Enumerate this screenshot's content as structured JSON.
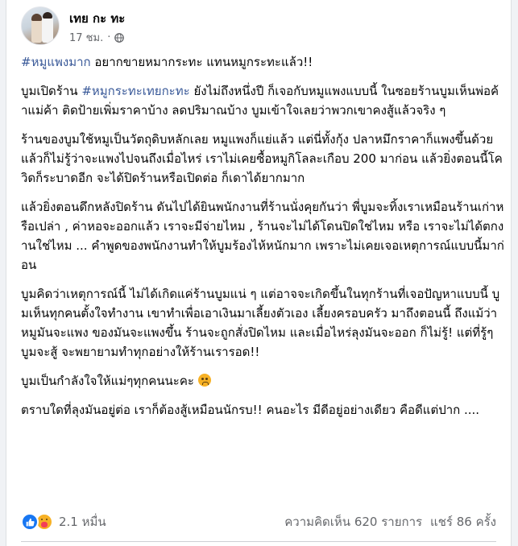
{
  "post": {
    "author": "เทย กะ ทะ",
    "time": "17 ชม.",
    "separator": "·",
    "privacy_icon": "globe-icon",
    "more_icon": "more-options-icon"
  },
  "content": {
    "p1": {
      "hashtag": "#หมูแพงมาก",
      "text": " อยากขายหมากระทะ แทนหมูกระทะแล้ว!!"
    },
    "p2": {
      "prefix": "บูมเปิดร้าน ",
      "hashtag": "#หมูกระทะเทยกะทะ",
      "text": " ยังไม่ถึงหนึ่งปี ก็เจอกับหมูแพงแบบนี้ ในซอยร้านบูมเห็นพ่อค้าแม่ค้า ติดป้ายเพิ่มราคาบ้าง ลดปริมาณบ้าง บูมเข้าใจเลยว่าพวกเขาคงสู้แล้วจริง ๆ"
    },
    "p3": "ร้านของบูมใช้หมูเป็นวัตถุดิบหลักเลย หมูแพงก็แย่แล้ว แต่นี่ทั้งกุ้ง ปลาหมึกราคาก็แพงขึ้นด้วย แล้วก็ไม่รู้ว่าจะแพงไปจนถึงเมื่อไหร่ เราไม่เคยซื้อหมูกิโลละเกือบ 200 มาก่อน แล้วยิ่งตอนนี้โควิดก็ระบาดอีก จะได้ปิดร้านหรือเปิดต่อ ก็เดาได้ยากมาก",
    "p4": "แล้วยิ่งตอนดึกหลังปิดร้าน ดันไปได้ยินพนักงานที่ร้านนั่งคุยกันว่า พี่บูมจะทิ้งเราเหมือนร้านเก่าหรือเปล่า , ค่าหอจะออกแล้ว เราจะมีจ่ายไหม , ร้านจะไม่ได้โดนปิดใช่ไหม หรือ เราจะไม่ได้ตกงานใช่ไหม ... คำพูดของพนักงานทำให้บูมร้องไห้หนักมาก เพราะไม่เคยเจอเหตุการณ์แบบนี้มาก่อน",
    "p5": "บูมคิดว่าเหตุการณ์นี้ ไม่ได้เกิดแค่ร้านบูมแน่ ๆ แต่อาจจะเกิดขึ้นในทุกร้านที่เจอปัญหาแบบนี้ บูมเห็นทุกคนตั้งใจทำงาน เขาทำเพื่อเอาเงินมาเลี้ยงตัวเอง เลี้ยงครอบครัว มาถึงตอนนี้ ถึงแม้ว่าหมูมันจะแพง ของมันจะแพงขึ้น ร้านจะถูกสั่งปิดไหม และเมื่อไหร่ลุงมันจะออก ก็ไม่รู้! แต่ที่รู้ๆ บูมจะสู้ จะพยายามทำทุกอย่างให้ร้านเรารอด!!",
    "p6": "บูมเป็นกำลังใจให้แม่ๆทุกคนนะคะ ",
    "p6_emoji": "pleading-face-emoji",
    "p7": "ตราบใดที่ลุงมันอยู่ต่อ เราก็ต้องสู้เหมือนนักรบ!! คนอะไร มีดีอยู่อย่างเดียว คือดีแต่ปาก ...."
  },
  "footer": {
    "reaction_icons": [
      "like-icon",
      "care-icon"
    ],
    "reaction_count": "2.1 หมื่น",
    "comments": "ความคิดเห็น 620 รายการ",
    "shares": "แชร์ 86 ครั้ง"
  },
  "colors": {
    "hashtag": "#385898",
    "like": "#1877f2",
    "care": "#f7b125",
    "secondary_text": "#65676b"
  }
}
